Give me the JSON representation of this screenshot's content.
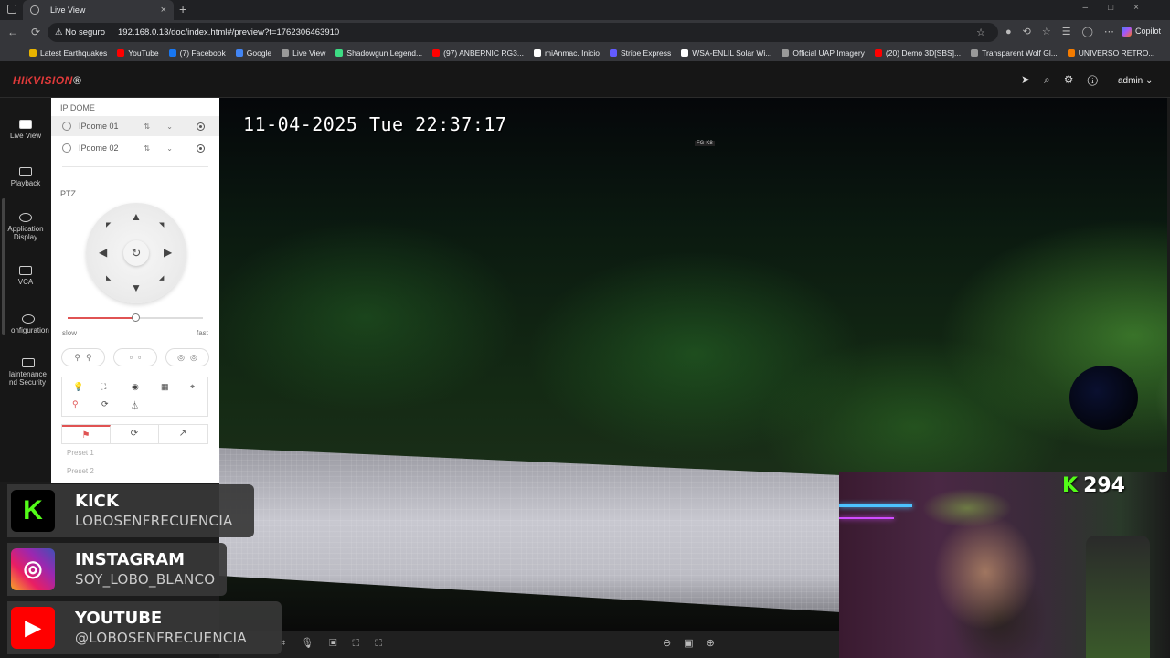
{
  "browser": {
    "tab_title": "Live View",
    "security_label": "No seguro",
    "url": "192.168.0.13/doc/index.html#/preview?t=1762306463910",
    "copilot_label": "Copilot",
    "bookmarks": [
      {
        "label": "Latest Earthquakes",
        "color": "#e8b400"
      },
      {
        "label": "YouTube",
        "color": "#ff0000"
      },
      {
        "label": "(7) Facebook",
        "color": "#1877f2"
      },
      {
        "label": "Google",
        "color": "#4285f4"
      },
      {
        "label": "Live View",
        "color": "#999999"
      },
      {
        "label": "Shadowgun Legend...",
        "color": "#3ddc84"
      },
      {
        "label": "(97) ANBERNIC RG3...",
        "color": "#ff0000"
      },
      {
        "label": "miAnmac. Inicio",
        "color": "#ffffff"
      },
      {
        "label": "Stripe Express",
        "color": "#635bff"
      },
      {
        "label": "WSA-ENLIL Solar Wi...",
        "color": "#ffffff"
      },
      {
        "label": "Official UAP Imagery",
        "color": "#999999"
      },
      {
        "label": "(20) Demo 3D[SBS]...",
        "color": "#ff0000"
      },
      {
        "label": "Transparent Wolf Gl...",
        "color": "#999999"
      },
      {
        "label": "UNIVERSO RETRO...",
        "color": "#f57c00"
      }
    ]
  },
  "app": {
    "logo_brand": "HIKVISION",
    "logo_registered": "®",
    "user": "admin",
    "header_icons": [
      "send-icon",
      "search-icon",
      "settings-icon",
      "info-icon"
    ]
  },
  "leftnav": {
    "items": [
      {
        "label": "Live View",
        "active": true
      },
      {
        "label": "Playback"
      },
      {
        "label": "Application Display"
      },
      {
        "label": "VCA"
      },
      {
        "label": "Configuration"
      },
      {
        "label": "Maintenance and Security"
      }
    ],
    "visible_labels": [
      "Live View",
      "Playback",
      "Application\nDisplay",
      "VCA",
      "onfiguration",
      "laintenance\nnd Security"
    ]
  },
  "panel": {
    "section_title": "IP DOME",
    "cameras": [
      {
        "label": "IPdome 01",
        "selected": true
      },
      {
        "label": "IPdome 02",
        "selected": false
      }
    ],
    "ptz_title": "PTZ",
    "speed_slow": "slow",
    "speed_fast": "fast",
    "speed_value": 0.5,
    "presets": [
      "Preset 1",
      "Preset 2"
    ]
  },
  "video": {
    "osd_timestamp": "11-04-2025 Tue 22:37:17",
    "plate_text": "FG-K8"
  },
  "overlay": {
    "kick_count_k": "K",
    "kick_count": "294",
    "kick": {
      "title": "KICK",
      "handle": "LOBOSENFRECUENCIA",
      "logo": "K"
    },
    "instagram": {
      "title": "INSTAGRAM",
      "handle": "SOY_LOBO_BLANCO"
    },
    "youtube": {
      "title": "YOUTUBE",
      "handle": "@LOBOSENFRECUENCIA"
    }
  }
}
